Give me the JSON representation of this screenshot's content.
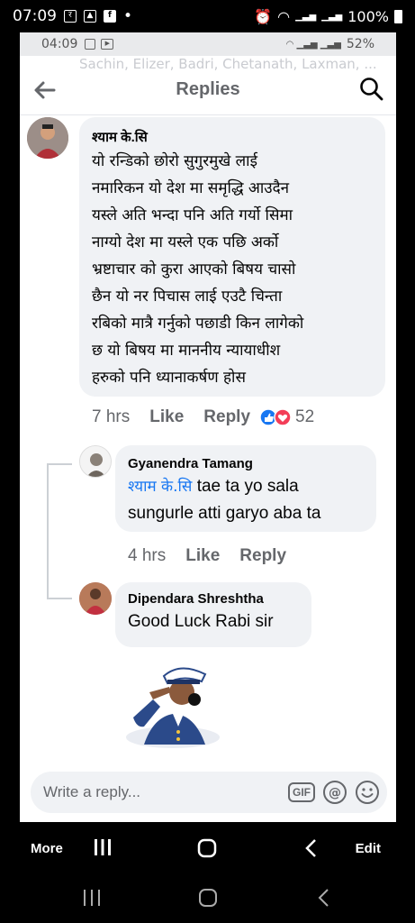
{
  "status_bar": {
    "time": "07:09",
    "battery": "100%"
  },
  "inner_status": {
    "time": "04:09",
    "battery": "52%"
  },
  "ghost_title": "Sachin, Elizer, Badri, Chetanath, Laxman, ...",
  "appbar": {
    "title": "Replies"
  },
  "main_comment": {
    "author": "श्याम के.सि",
    "lines": [
      "यो रन्डिको छोरो सुगुरमुखे लाई",
      "नमारिकन यो देश मा समृद्धि आउदैन",
      "यस्ले अति भन्दा पनि अति गर्यो सिमा",
      "नाग्यो देश मा यस्ले एक पछि अर्को",
      "भ्रष्टाचार को कुरा आएको बिषय चासो",
      "छैन यो नर पिचास लाई एउटै चिन्ता",
      "रबिको मात्रै गर्नुको पछाडी किन लागेको",
      "छ  यो बिषय मा माननीय न्यायाधीश",
      "हरुको पनि ध्यानाकर्षण होस"
    ],
    "time": "7 hrs",
    "like": "Like",
    "reply": "Reply",
    "reaction_count": "52"
  },
  "reply1": {
    "author": "Gyanendra Tamang",
    "tag": "श्याम के.सि",
    "text_line1": " tae ta yo sala",
    "text_line2": "sungurle  atti garyo aba ta",
    "time": "4 hrs",
    "like": "Like",
    "reply": "Reply"
  },
  "reply2": {
    "author": "Dipendara Shreshtha",
    "text": "Good Luck Rabi sir"
  },
  "composer": {
    "placeholder": "Write a reply...",
    "gif": "GIF"
  },
  "editbar": {
    "more": "More",
    "edit": "Edit"
  },
  "colors": {
    "accent": "#1877f2",
    "bubble": "#f0f2f5",
    "meta": "#65676b"
  }
}
